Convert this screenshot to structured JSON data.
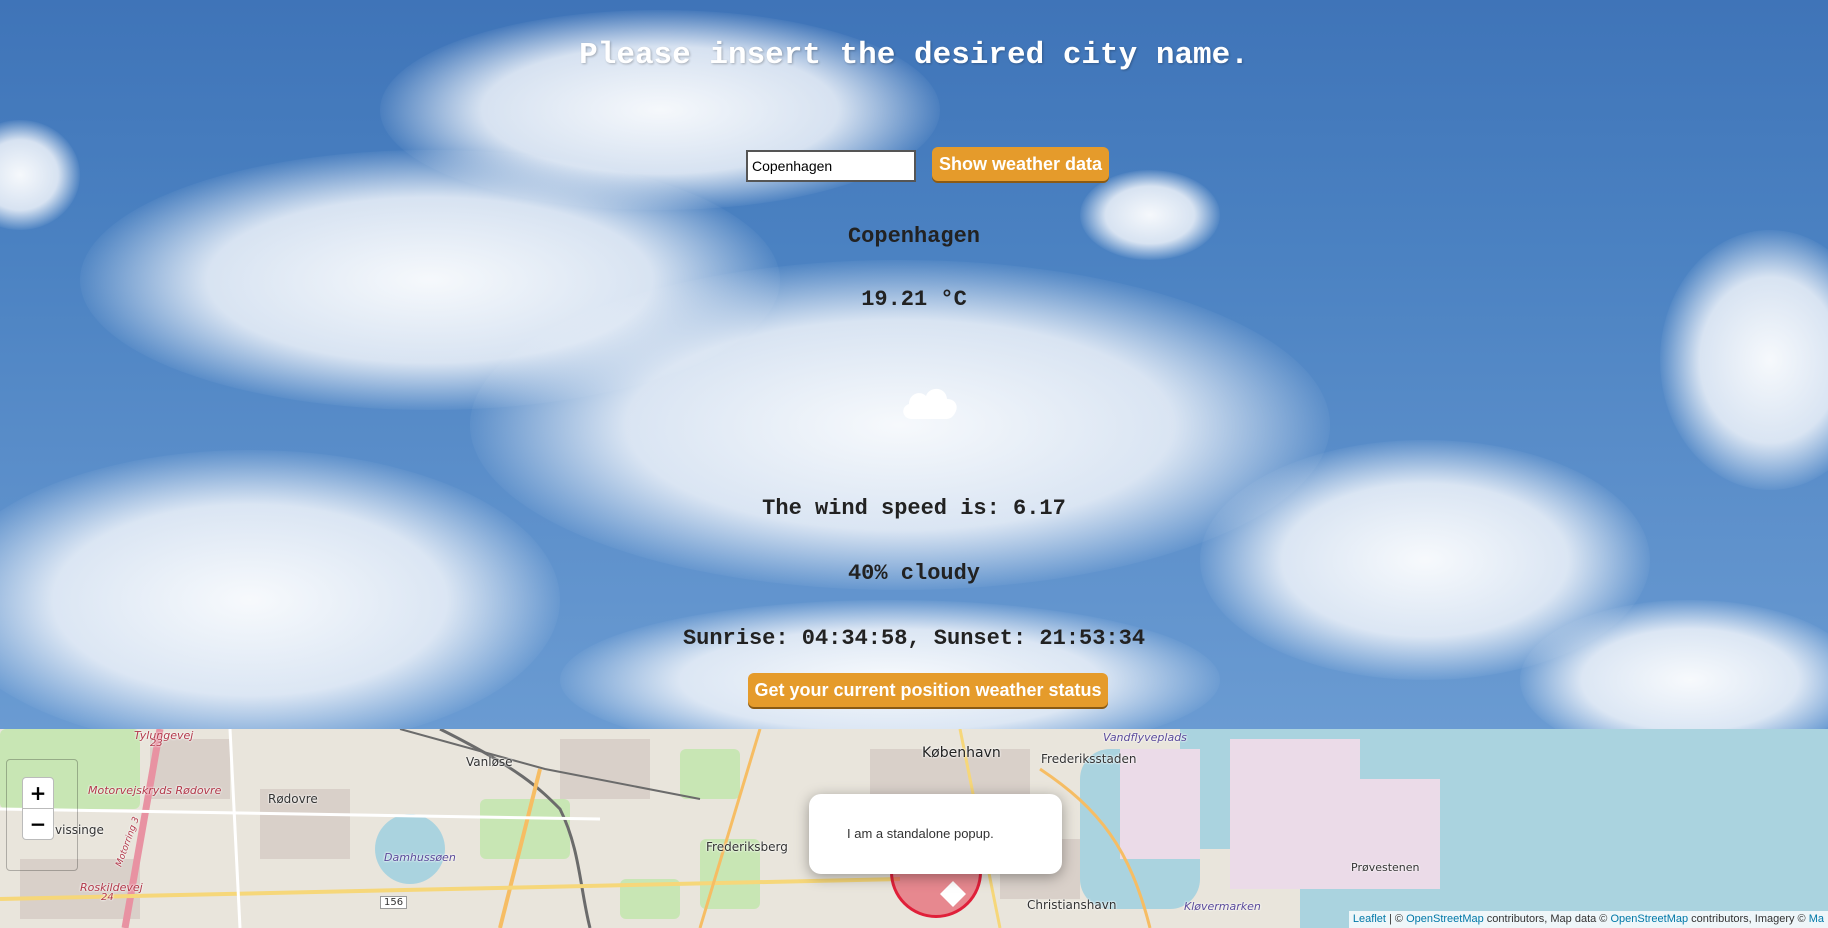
{
  "header": {
    "title": "Please insert the desired city name."
  },
  "search": {
    "value": "Copenhagen",
    "button_label": "Show weather data"
  },
  "weather": {
    "city": "Copenhagen",
    "temperature": "19.21 °C",
    "icon": "cloud-icon",
    "wind": "The wind speed is: 6.17",
    "cloudiness": "40% cloudy",
    "sun": "Sunrise: 04:34:58, Sunset: 21:53:34"
  },
  "position_button": {
    "label": "Get your current position weather status"
  },
  "map": {
    "zoom_in": "+",
    "zoom_out": "−",
    "popup": "I am a standalone popup.",
    "places": {
      "kobenhavn": "København",
      "frederiksstaden": "Frederiksstaden",
      "vanlose": "Vanløse",
      "rodovre": "Rødovre",
      "hvissinge": "Hvissinge",
      "frederiksberg": "Frederiksberg",
      "christianshavn": "Christianshavn",
      "provestenen": "Prøvestenen",
      "damhussoen": "Damhussøen",
      "klovermarken": "Kløvermarken",
      "vandflyveplads": "Vandflyveplads",
      "tylungevej": "Tylungevej",
      "motorvejskryds": "Motorvejskryds Rødovre",
      "roskildevej": "Roskildevej",
      "motorring": "Motorring 3",
      "road_156": "156",
      "road_23": "23",
      "road_24": "24"
    },
    "attribution": {
      "leaflet": "Leaflet",
      "sep1": " | © ",
      "osm1": "OpenStreetMap",
      "text1": " contributors, Map data © ",
      "osm2": "OpenStreetMap",
      "text2": " contributors, Imagery © ",
      "mapbox": "Ma"
    }
  }
}
